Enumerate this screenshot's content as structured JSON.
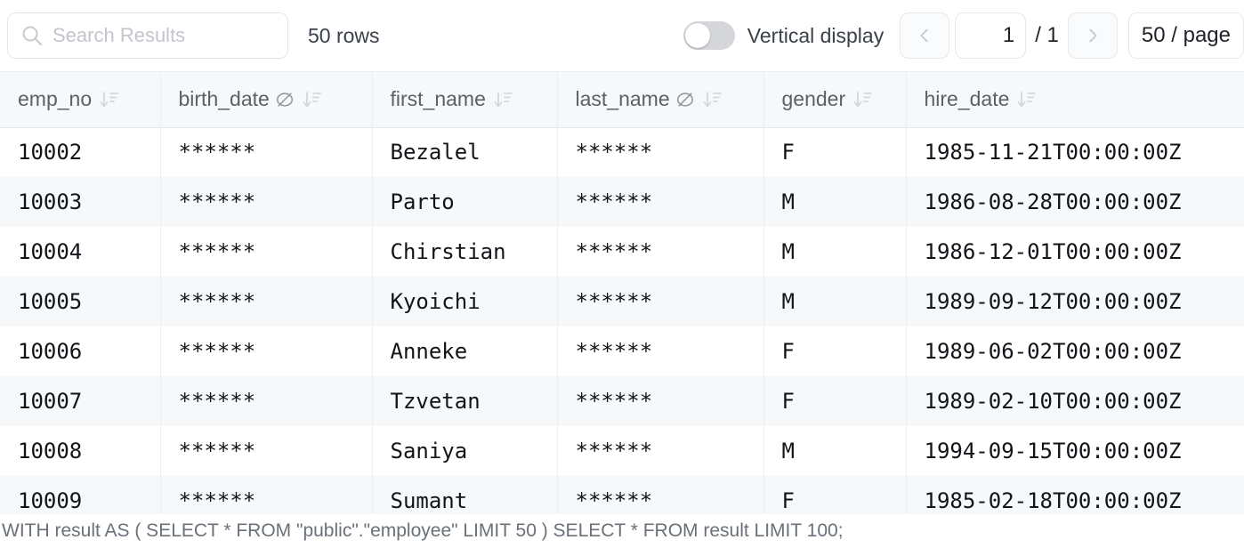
{
  "toolbar": {
    "search_placeholder": "Search Results",
    "search_value": "",
    "search_icon": "search-icon",
    "rows_count_label": "50 rows",
    "vertical_display_label": "Vertical display",
    "vertical_display_on": false,
    "prev_icon": "chevron-left-icon",
    "next_icon": "chevron-right-icon",
    "page_value": "1",
    "page_total_label": "/ 1",
    "per_page_label": "50 / page"
  },
  "table": {
    "columns": [
      {
        "key": "emp_no",
        "label": "emp_no",
        "masked": false,
        "sort_icon": "sort-descending-icon"
      },
      {
        "key": "birth_date",
        "label": "birth_date",
        "masked": true,
        "mask_icon": "eye-off-icon",
        "sort_icon": "sort-descending-icon"
      },
      {
        "key": "first_name",
        "label": "first_name",
        "masked": false,
        "sort_icon": "sort-descending-icon"
      },
      {
        "key": "last_name",
        "label": "last_name",
        "masked": true,
        "mask_icon": "eye-off-icon",
        "sort_icon": "sort-descending-icon"
      },
      {
        "key": "gender",
        "label": "gender",
        "masked": false,
        "sort_icon": "sort-descending-icon"
      },
      {
        "key": "hire_date",
        "label": "hire_date",
        "masked": false,
        "sort_icon": "sort-descending-icon"
      }
    ],
    "rows": [
      {
        "emp_no": "10002",
        "birth_date": "******",
        "first_name": "Bezalel",
        "last_name": "******",
        "gender": "F",
        "hire_date": "1985-11-21T00:00:00Z"
      },
      {
        "emp_no": "10003",
        "birth_date": "******",
        "first_name": "Parto",
        "last_name": "******",
        "gender": "M",
        "hire_date": "1986-08-28T00:00:00Z"
      },
      {
        "emp_no": "10004",
        "birth_date": "******",
        "first_name": "Chirstian",
        "last_name": "******",
        "gender": "M",
        "hire_date": "1986-12-01T00:00:00Z"
      },
      {
        "emp_no": "10005",
        "birth_date": "******",
        "first_name": "Kyoichi",
        "last_name": "******",
        "gender": "M",
        "hire_date": "1989-09-12T00:00:00Z"
      },
      {
        "emp_no": "10006",
        "birth_date": "******",
        "first_name": "Anneke",
        "last_name": "******",
        "gender": "F",
        "hire_date": "1989-06-02T00:00:00Z"
      },
      {
        "emp_no": "10007",
        "birth_date": "******",
        "first_name": "Tzvetan",
        "last_name": "******",
        "gender": "F",
        "hire_date": "1989-02-10T00:00:00Z"
      },
      {
        "emp_no": "10008",
        "birth_date": "******",
        "first_name": "Saniya",
        "last_name": "******",
        "gender": "M",
        "hire_date": "1994-09-15T00:00:00Z"
      },
      {
        "emp_no": "10009",
        "birth_date": "******",
        "first_name": "Sumant",
        "last_name": "******",
        "gender": "F",
        "hire_date": "1985-02-18T00:00:00Z"
      }
    ]
  },
  "footer": {
    "sql_text": "WITH result AS ( SELECT * FROM \"public\".\"employee\" LIMIT 50 ) SELECT * FROM result LIMIT 100;"
  },
  "colors": {
    "header_bg": "#f7f8f9",
    "stripe_bg": "#f7f8f9",
    "border": "#eceef0",
    "text": "#1f2329",
    "muted_text": "#6a7179"
  }
}
